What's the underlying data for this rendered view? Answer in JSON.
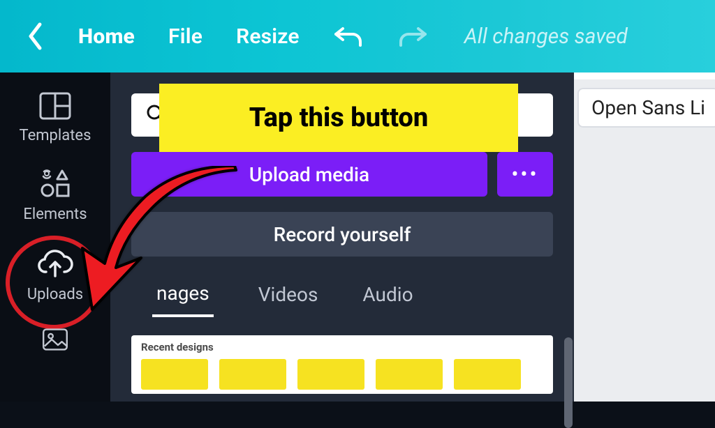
{
  "topbar": {
    "home": "Home",
    "file": "File",
    "resize": "Resize",
    "status": "All changes saved"
  },
  "sidebar": {
    "items": [
      {
        "label": "Templates"
      },
      {
        "label": "Elements"
      },
      {
        "label": "Uploads"
      }
    ]
  },
  "panel": {
    "upload_label": "Upload media",
    "more_label": "•••",
    "record_label": "Record yourself",
    "tabs": {
      "images": "nages",
      "videos": "Videos",
      "audio": "Audio"
    },
    "recent_heading": "Recent designs"
  },
  "canvas": {
    "font_button": "Open Sans Li"
  },
  "annotation": {
    "callout": "Tap this button"
  },
  "colors": {
    "accent_purple": "#7b1ef7",
    "annotation_yellow": "#fbee23",
    "annotation_red": "#d91f27"
  }
}
